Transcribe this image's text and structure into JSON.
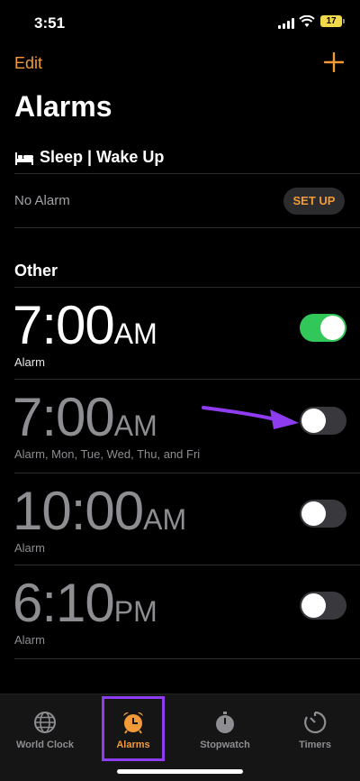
{
  "status": {
    "time": "3:51",
    "battery": "17"
  },
  "header": {
    "edit_label": "Edit",
    "title": "Alarms"
  },
  "sleep": {
    "heading": "Sleep | Wake Up",
    "status": "No Alarm",
    "setup_label": "SET UP"
  },
  "other": {
    "heading": "Other"
  },
  "alarms": [
    {
      "time": "7:00",
      "ampm": "AM",
      "label": "Alarm",
      "enabled": true
    },
    {
      "time": "7:00",
      "ampm": "AM",
      "label": "Alarm, Mon, Tue, Wed, Thu, and Fri",
      "enabled": false
    },
    {
      "time": "10:00",
      "ampm": "AM",
      "label": "Alarm",
      "enabled": false
    },
    {
      "time": "6:10",
      "ampm": "PM",
      "label": "Alarm",
      "enabled": false
    }
  ],
  "tabs": [
    {
      "label": "World Clock",
      "icon": "globe-icon"
    },
    {
      "label": "Alarms",
      "icon": "alarm-clock-icon",
      "active": true
    },
    {
      "label": "Stopwatch",
      "icon": "stopwatch-icon"
    },
    {
      "label": "Timers",
      "icon": "timer-icon"
    }
  ],
  "colors": {
    "accent": "#f19a37",
    "toggle_on": "#32c759",
    "highlight": "#8e3cf0"
  }
}
